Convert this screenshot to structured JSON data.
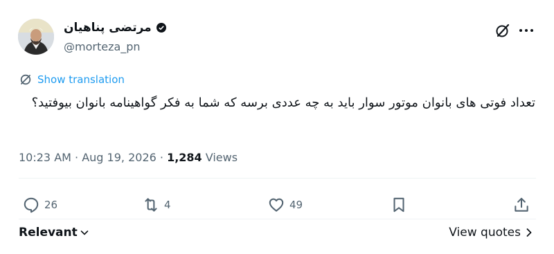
{
  "author": {
    "display_name": "مرتضی پناهیان",
    "handle": "@morteza_pn",
    "badge_icon": "verified-badge-icon",
    "avatar_icon": "profile-avatar"
  },
  "header_actions": {
    "grok_icon": "grok-icon",
    "more_icon": "more-dots-icon"
  },
  "translation": {
    "label": "Show translation",
    "icon": "translate-icon"
  },
  "tweet": {
    "text": "تعداد فوتی های بانوان موتور سوار باید به چه عددی برسه که شما به فکر گواهینامه بانوان بیوفتید؟"
  },
  "meta": {
    "time": "10:23 AM",
    "sep1": " · ",
    "date": "Aug 19, 2026",
    "sep2": " · ",
    "views_count": "1,284",
    "views_label": " Views"
  },
  "actions": {
    "reply_count": "26",
    "retweet_count": "4",
    "like_count": "49"
  },
  "footer": {
    "sort_label": "Relevant",
    "view_quotes_label": "View quotes"
  },
  "colors": {
    "text": "#0f1419",
    "secondary": "#536471",
    "link": "#1d9bf0",
    "divider": "#eff3f4"
  }
}
